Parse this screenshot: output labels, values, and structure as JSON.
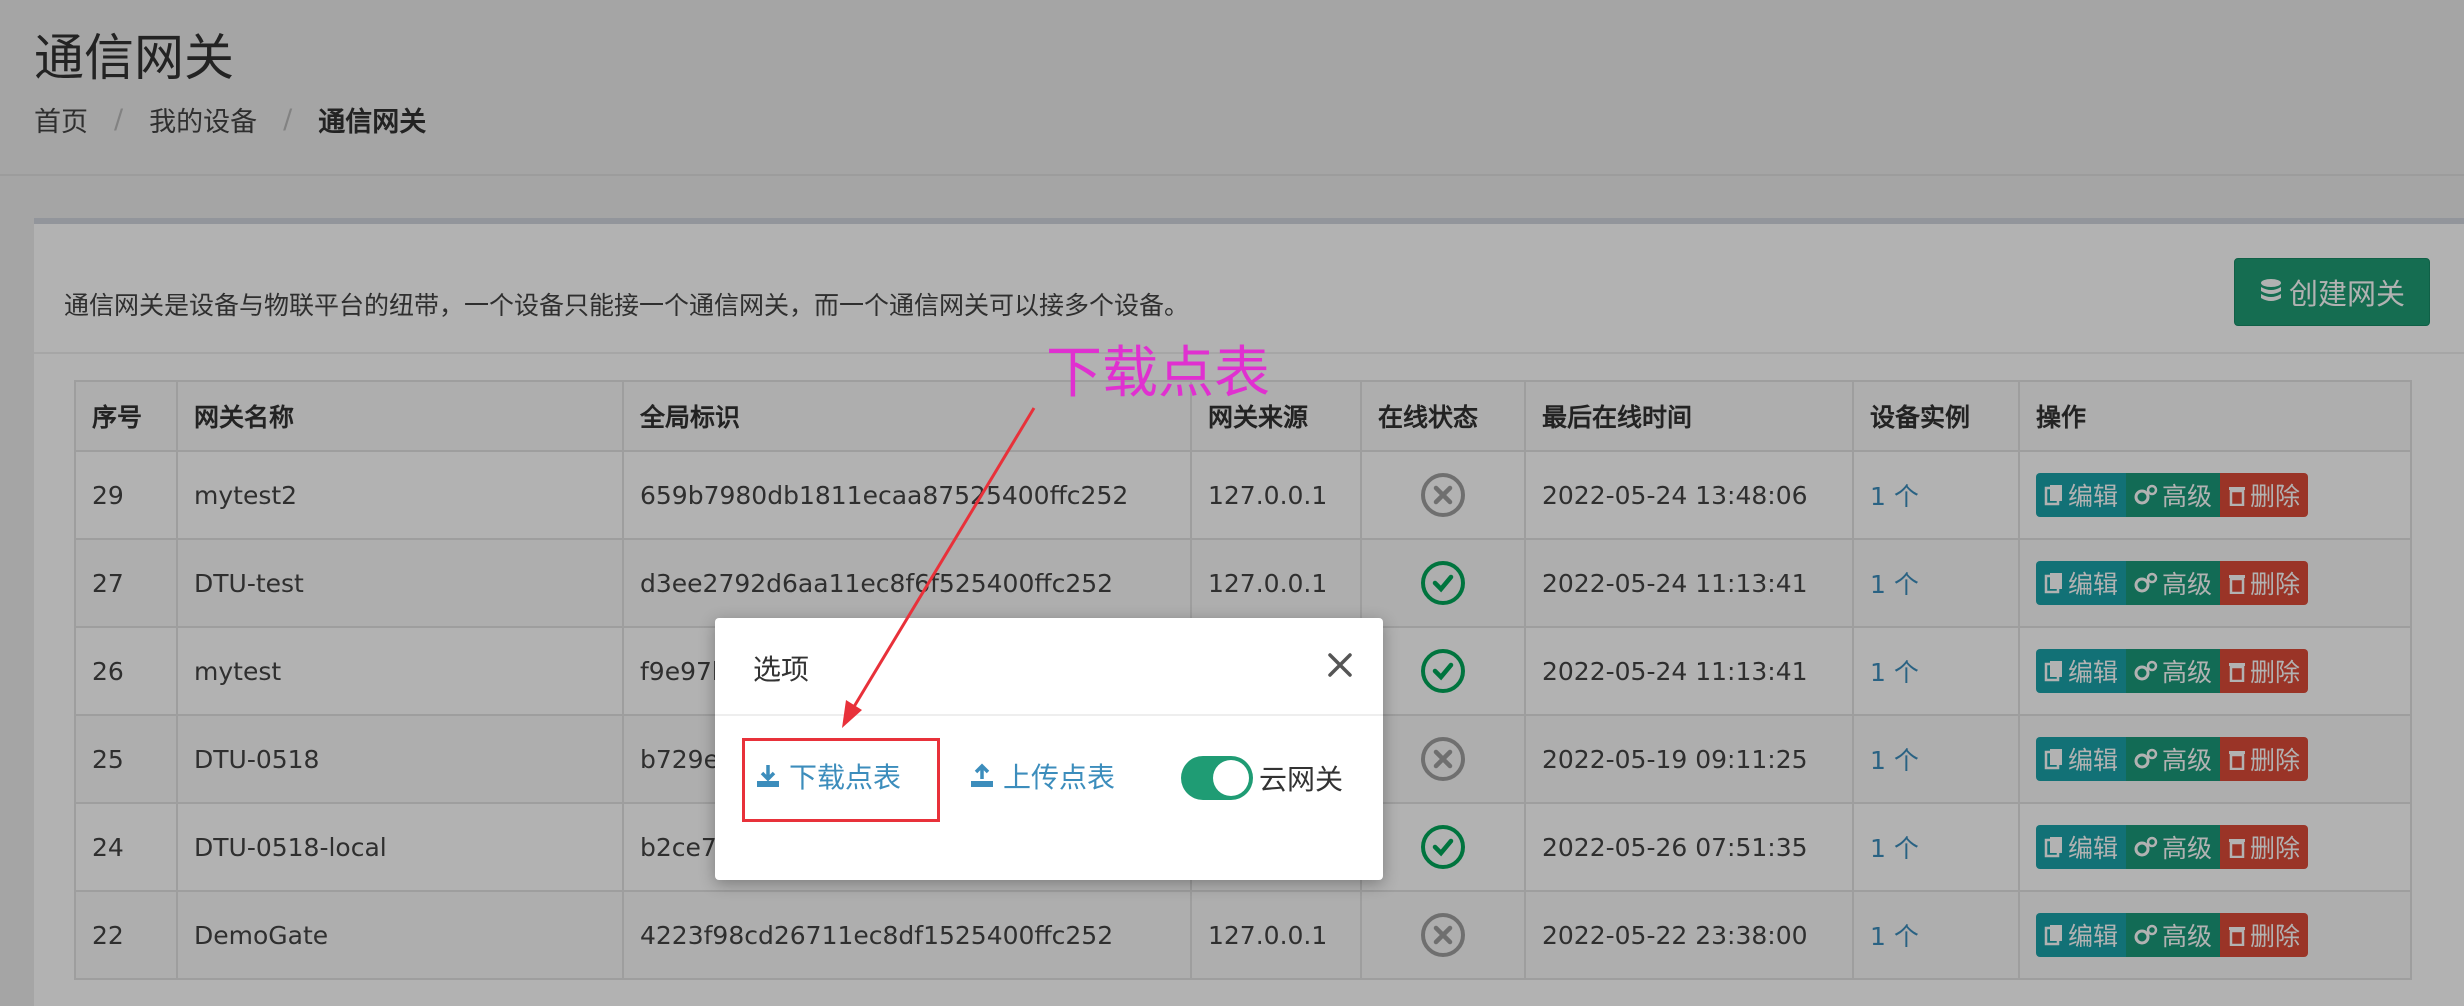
{
  "header": {
    "title": "通信网关",
    "breadcrumb": [
      "首页",
      "我的设备",
      "通信网关"
    ]
  },
  "box": {
    "description": "通信网关是设备与物联平台的纽带，一个设备只能接一个通信网关，而一个通信网关可以接多个设备。",
    "create_button": "创建网关"
  },
  "table": {
    "headers": [
      "序号",
      "网关名称",
      "全局标识",
      "网关来源",
      "在线状态",
      "最后在线时间",
      "设备实例",
      "操作"
    ],
    "rows": [
      {
        "id": "29",
        "name": "mytest2",
        "uid": "659b7980db1811ecaa87525400ffc252",
        "source": "127.0.0.1",
        "online": false,
        "last": "2022-05-24 13:48:06",
        "count": "1 个"
      },
      {
        "id": "27",
        "name": "DTU-test",
        "uid": "d3ee2792d6aa11ec8f6f525400ffc252",
        "source": "127.0.0.1",
        "online": true,
        "last": "2022-05-24 11:13:41",
        "count": "1 个"
      },
      {
        "id": "26",
        "name": "mytest",
        "uid": "f9e97b",
        "source": "",
        "online": true,
        "last": "2022-05-24 11:13:41",
        "count": "1 个"
      },
      {
        "id": "25",
        "name": "DTU-0518",
        "uid": "b729e",
        "source": "",
        "online": false,
        "last": "2022-05-19 09:11:25",
        "count": "1 个"
      },
      {
        "id": "24",
        "name": "DTU-0518-local",
        "uid": "b2ce7",
        "source": "",
        "online": true,
        "last": "2022-05-26 07:51:35",
        "count": "1 个"
      },
      {
        "id": "22",
        "name": "DemoGate",
        "uid": "4223f98cd26711ec8df1525400ffc252",
        "source": "127.0.0.1",
        "online": false,
        "last": "2022-05-22 23:38:00",
        "count": "1 个"
      }
    ],
    "ops": {
      "edit": "编辑",
      "advanced": "高级",
      "delete": "删除"
    }
  },
  "modal": {
    "title": "选项",
    "download": "下载点表",
    "upload": "上传点表",
    "toggle_label": "云网关",
    "toggle_on": true
  },
  "annotation": {
    "text": "下载点表",
    "color": "#e030d0"
  },
  "colors": {
    "accent_green": "#1f9c74",
    "link_blue": "#3c8dbc",
    "danger_red": "#dd4b39"
  }
}
